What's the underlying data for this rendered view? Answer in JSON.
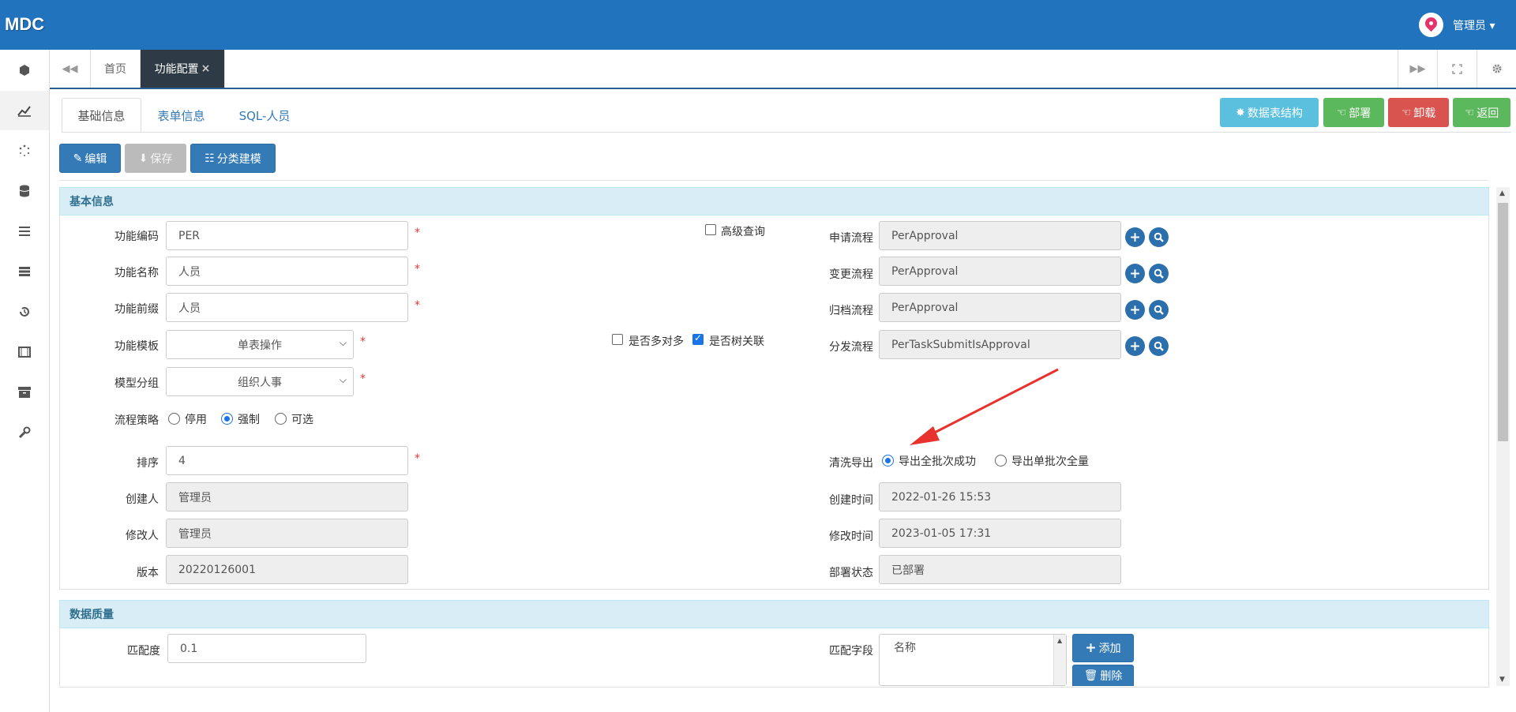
{
  "app": {
    "logo": "MDC",
    "user": "管理员 ▾"
  },
  "sidebar": {
    "icons": [
      "cube-icon",
      "chart-icon",
      "spinner-icon",
      "database-icon",
      "list-icon",
      "server-icon",
      "history-icon",
      "film-icon",
      "archive-icon",
      "wrench-icon"
    ]
  },
  "tabs": {
    "home": "首页",
    "active": "功能配置",
    "close": "×"
  },
  "subtabs": [
    "基础信息",
    "表单信息",
    "SQL-人员"
  ],
  "actions": {
    "table_structure": "数据表结构",
    "deploy": "部署",
    "undeploy": "卸载",
    "back": "返回"
  },
  "toolbar": {
    "edit": "编辑",
    "save": "保存",
    "category_model": "分类建模"
  },
  "basic": {
    "title": "基本信息",
    "code_label": "功能编码",
    "code_value": "PER",
    "name_label": "功能名称",
    "name_value": "人员",
    "prefix_label": "功能前缀",
    "prefix_value": "人员",
    "template_label": "功能模板",
    "template_value": "单表操作",
    "group_label": "模型分组",
    "group_value": "组织人事",
    "strategy_label": "流程策略",
    "strategy_options": [
      "停用",
      "强制",
      "可选"
    ],
    "strategy_selected": "强制",
    "order_label": "排序",
    "order_value": "4",
    "creator_label": "创建人",
    "creator_value": "管理员",
    "modifier_label": "修改人",
    "modifier_value": "管理员",
    "version_label": "版本",
    "version_value": "20220126001",
    "advanced_query": "高级查询",
    "advanced_query_checked": false,
    "many_to_many": "是否多对多",
    "many_to_many_checked": false,
    "tree_relation": "是否树关联",
    "tree_relation_checked": true,
    "apply_flow_label": "申请流程",
    "apply_flow_value": "PerApproval",
    "change_flow_label": "变更流程",
    "change_flow_value": "PerApproval",
    "archive_flow_label": "归档流程",
    "archive_flow_value": "PerApproval",
    "dispatch_flow_label": "分发流程",
    "dispatch_flow_value": "PerTaskSubmitIsApproval",
    "export_label": "清洗导出",
    "export_options": [
      "导出全批次成功",
      "导出单批次全量"
    ],
    "export_selected": "导出全批次成功",
    "created_time_label": "创建时间",
    "created_time_value": "2022-01-26 15:53",
    "modified_time_label": "修改时间",
    "modified_time_value": "2023-01-05 17:31",
    "deploy_status_label": "部署状态",
    "deploy_status_value": "已部署"
  },
  "quality": {
    "title": "数据质量",
    "match_label": "匹配度",
    "match_value": "0.1",
    "field_label": "匹配字段",
    "field_items": [
      "名称"
    ],
    "add": "添加",
    "delete": "删除"
  },
  "colors": {
    "header": "#2173bd",
    "info": "#5bc0de",
    "success": "#5cb85c",
    "danger": "#d9534f",
    "primary": "#337ab7",
    "arrow": "#e8322d"
  }
}
